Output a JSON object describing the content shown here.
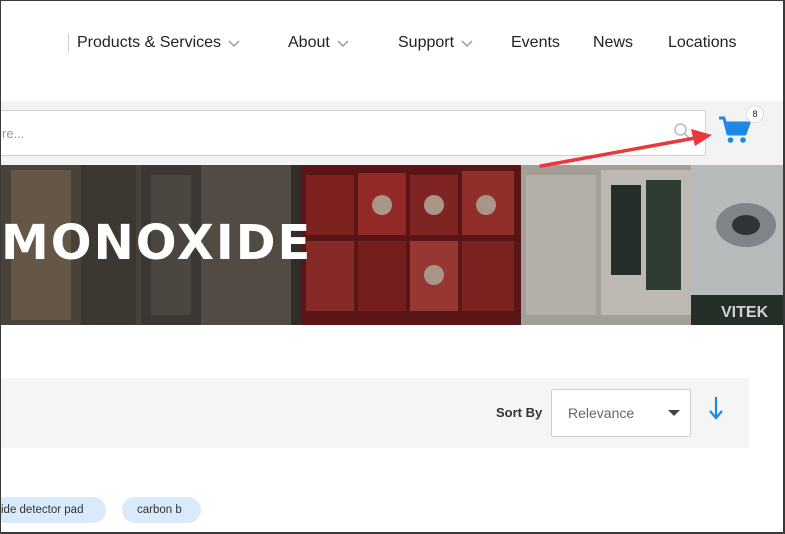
{
  "nav": {
    "items": [
      {
        "label": "Products & Services",
        "has_dropdown": true
      },
      {
        "label": "About",
        "has_dropdown": true
      },
      {
        "label": "Support",
        "has_dropdown": true
      },
      {
        "label": "Events",
        "has_dropdown": false
      },
      {
        "label": "News",
        "has_dropdown": false
      },
      {
        "label": "Locations",
        "has_dropdown": false
      }
    ]
  },
  "search": {
    "placeholder": "re...",
    "icon": "search-icon"
  },
  "cart": {
    "icon": "shopping-cart-icon",
    "count": "8",
    "color": "#1e88e5"
  },
  "hero": {
    "title": "MONOXIDE"
  },
  "sort": {
    "label": "Sort By",
    "selected": "Relevance",
    "direction_icon": "arrow-down-icon",
    "accent": "#1e88e5"
  },
  "chips": [
    {
      "label": "ide detector pad"
    },
    {
      "label": "carbon b"
    }
  ],
  "annotation": {
    "color": "#e8383d",
    "icon": "annotation-arrow"
  }
}
